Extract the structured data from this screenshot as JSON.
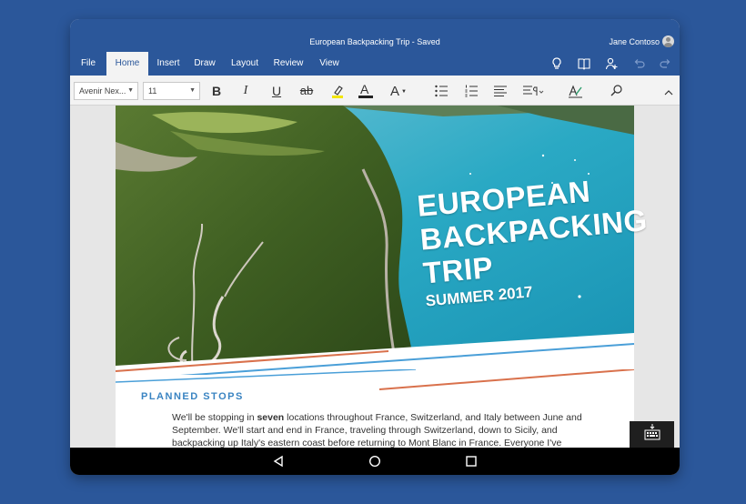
{
  "window": {
    "document_title": "European Backpacking Trip - Saved",
    "user_name": "Jane Contoso"
  },
  "tabs": [
    {
      "label": "File"
    },
    {
      "label": "Home",
      "active": true
    },
    {
      "label": "Insert"
    },
    {
      "label": "Draw"
    },
    {
      "label": "Layout"
    },
    {
      "label": "Review"
    },
    {
      "label": "View"
    }
  ],
  "title_icons": [
    "lightbulb-icon",
    "book-icon",
    "share-person-icon",
    "undo-icon",
    "redo-icon"
  ],
  "ribbon": {
    "font_name": "Avenir Nex...",
    "font_size": "11",
    "bold": "B",
    "italic": "I",
    "underline": "U",
    "strikethrough": "ab",
    "font_color_letter": "A",
    "font_style_letter": "A"
  },
  "document": {
    "hero_lines": [
      "EUROPEAN",
      "BACKPACKING",
      "TRIP"
    ],
    "hero_subtitle": "SUMMER 2017",
    "section_heading": "PLANNED STOPS",
    "paragraph_before_bold": "We'll be stopping in ",
    "paragraph_bold": "seven",
    "paragraph_after_bold": " locations throughout France, Switzerland, and Italy between June and September. We'll start and end in France, traveling through Switzerland, down to Sicily, and backpacking up Italy's eastern coast before returning to Mont Blanc in France. Everyone I've"
  },
  "colors": {
    "brand": "#2b579a",
    "highlight": "#f2e600",
    "heading": "#3a84c2",
    "stripe_orange": "#d9714c",
    "stripe_blue": "#4a9fd8"
  }
}
